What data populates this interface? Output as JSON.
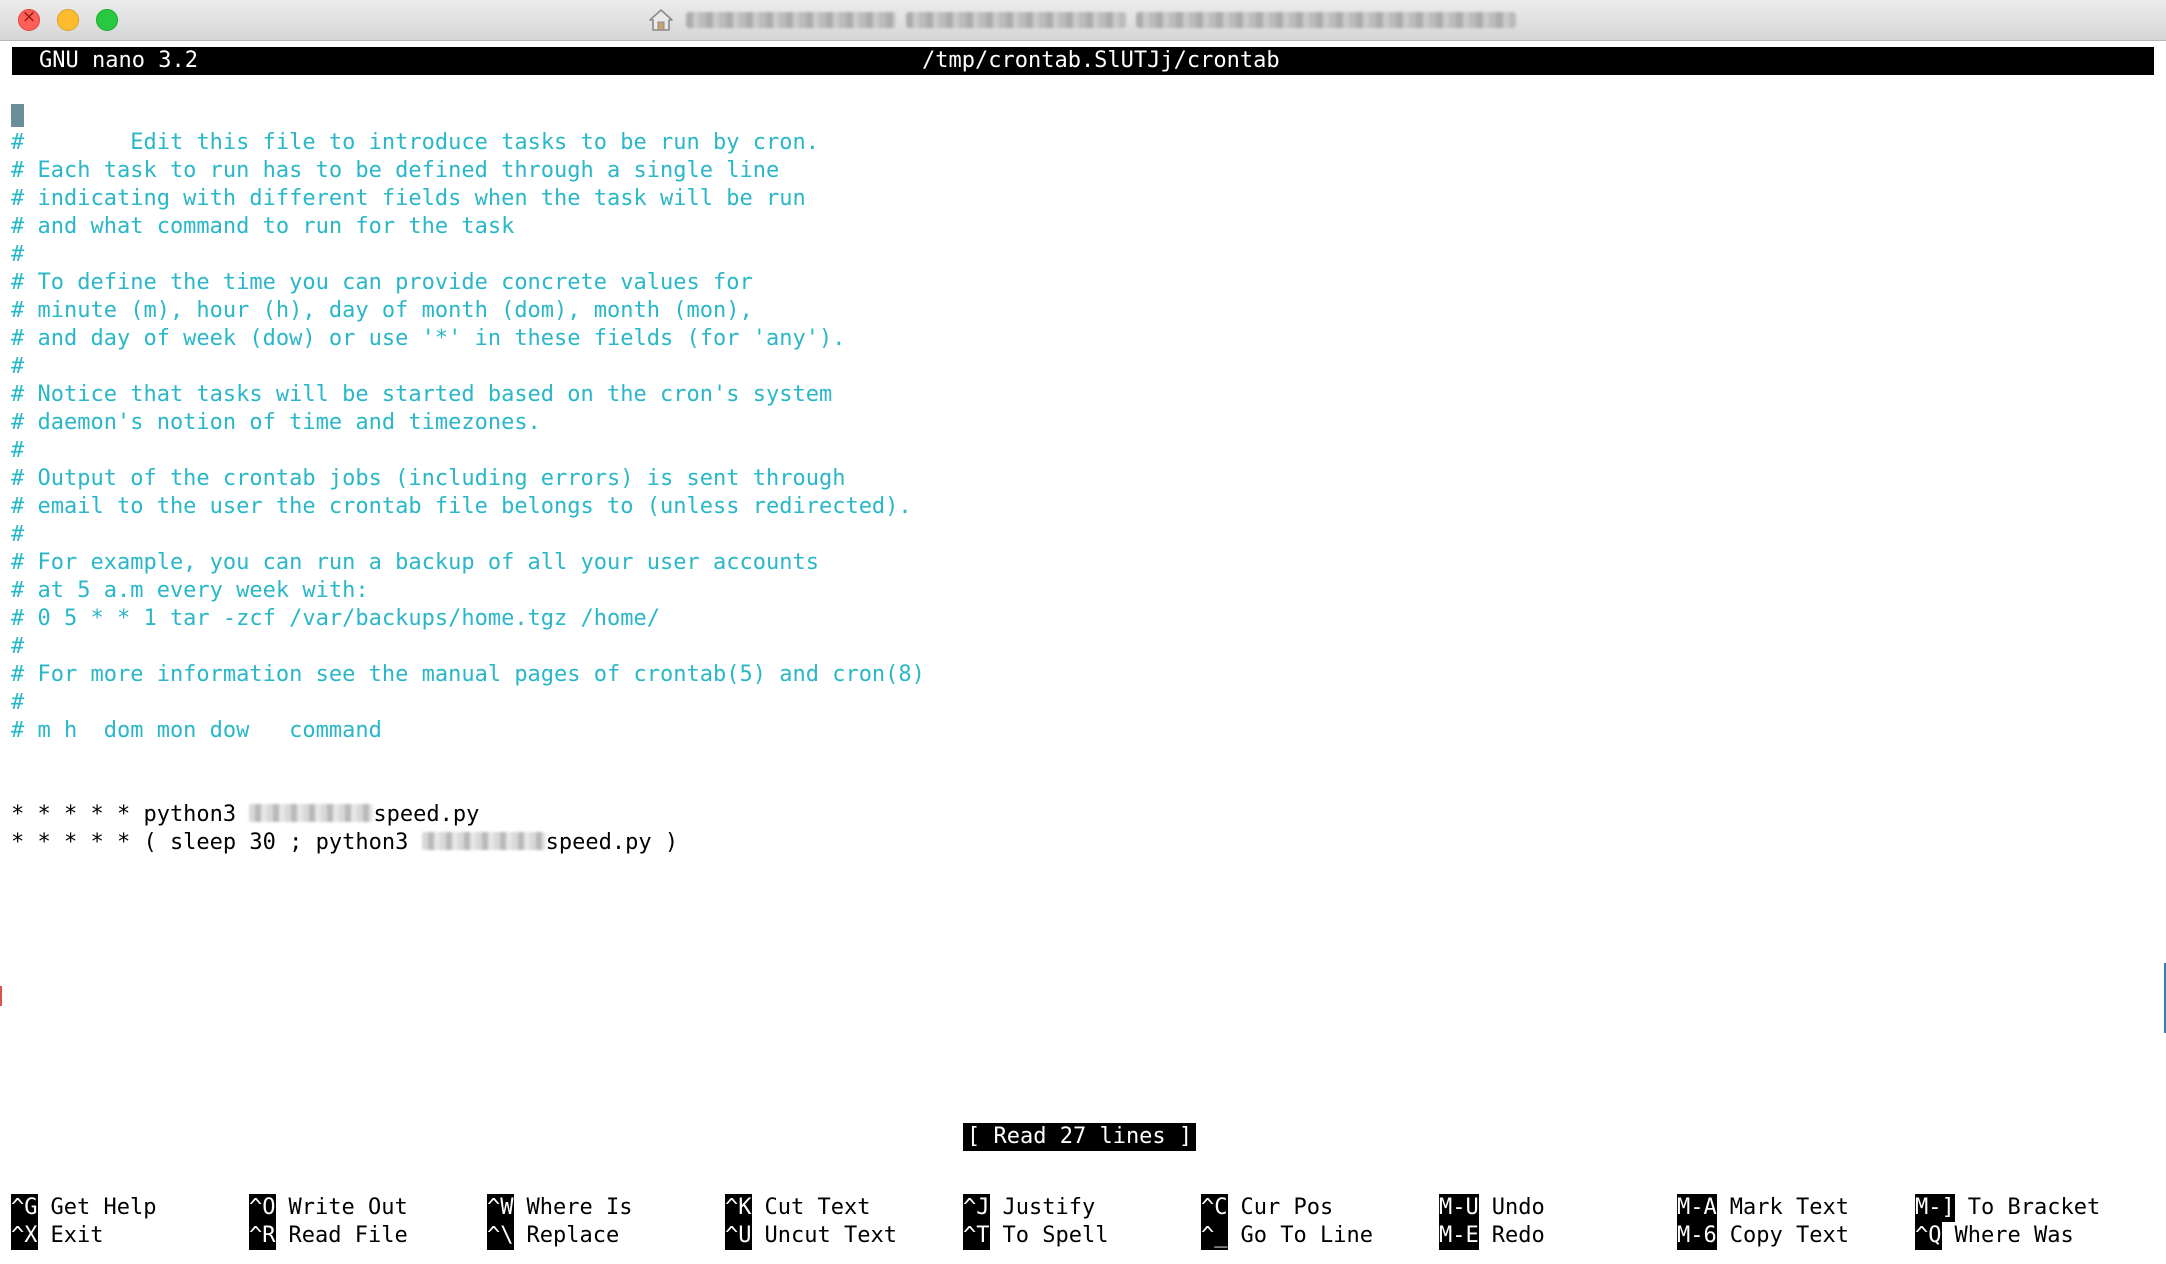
{
  "window": {
    "icon": "home-folder-icon"
  },
  "nano": {
    "version": "GNU nano 3.2",
    "file_path": "/tmp/crontab.SlUTJj/crontab",
    "status_message": "[ Read 27 lines ]"
  },
  "editor": {
    "lines": [
      " Edit this file to introduce tasks to be run by cron.",
      "#",
      "# Each task to run has to be defined through a single line",
      "# indicating with different fields when the task will be run",
      "# and what command to run for the task",
      "#",
      "# To define the time you can provide concrete values for",
      "# minute (m), hour (h), day of month (dom), month (mon),",
      "# and day of week (dow) or use '*' in these fields (for 'any').",
      "#",
      "# Notice that tasks will be started based on the cron's system",
      "# daemon's notion of time and timezones.",
      "#",
      "# Output of the crontab jobs (including errors) is sent through",
      "# email to the user the crontab file belongs to (unless redirected).",
      "#",
      "# For example, you can run a backup of all your user accounts",
      "# at 5 a.m every week with:",
      "# 0 5 * * 1 tar -zcf /var/backups/home.tgz /home/",
      "#",
      "# For more information see the manual pages of crontab(5) and cron(8)",
      "#",
      "# m h  dom mon dow   command"
    ],
    "job1_prefix": "* * * * * python3 ",
    "job1_suffix": "speed.py",
    "job2_prefix": "* * * * * ( sleep 30 ; python3 ",
    "job2_suffix": "speed.py )"
  },
  "shortcuts": {
    "row1": [
      {
        "key": "^G",
        "label": "Get Help"
      },
      {
        "key": "^O",
        "label": "Write Out"
      },
      {
        "key": "^W",
        "label": "Where Is"
      },
      {
        "key": "^K",
        "label": "Cut Text"
      },
      {
        "key": "^J",
        "label": "Justify"
      },
      {
        "key": "^C",
        "label": "Cur Pos"
      },
      {
        "key": "M-U",
        "label": "Undo"
      },
      {
        "key": "M-A",
        "label": "Mark Text"
      },
      {
        "key": "M-]",
        "label": "To Bracket"
      }
    ],
    "row2": [
      {
        "key": "^X",
        "label": "Exit"
      },
      {
        "key": "^R",
        "label": "Read File"
      },
      {
        "key": "^\\",
        "label": "Replace"
      },
      {
        "key": "^U",
        "label": "Uncut Text"
      },
      {
        "key": "^T",
        "label": "To Spell"
      },
      {
        "key": "^_",
        "label": "Go To Line"
      },
      {
        "key": "M-E",
        "label": "Redo"
      },
      {
        "key": "M-6",
        "label": "Copy Text"
      },
      {
        "key": "^Q",
        "label": "Where Was"
      }
    ]
  }
}
